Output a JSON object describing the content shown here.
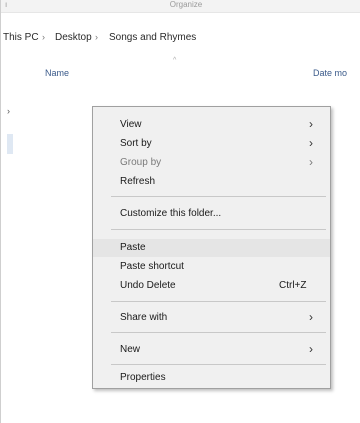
{
  "window": {
    "title_left": "ı",
    "title": "Organize"
  },
  "breadcrumb": {
    "items": [
      "This PC",
      "Desktop",
      "Songs and Rhymes"
    ],
    "separator": "›"
  },
  "columns": {
    "name": "Name",
    "date_modified": "Date mo",
    "sort_indicator": "^"
  },
  "navpane": {
    "arrow": "›"
  },
  "context_menu": {
    "items": [
      {
        "label": "View",
        "submenu": true
      },
      {
        "label": "Sort by",
        "submenu": true
      },
      {
        "label": "Group by",
        "submenu": true,
        "disabled": true
      },
      {
        "label": "Refresh"
      },
      {
        "label": "Customize this folder..."
      },
      {
        "label": "Paste",
        "highlighted": true
      },
      {
        "label": "Paste shortcut"
      },
      {
        "label": "Undo Delete",
        "shortcut": "Ctrl+Z"
      },
      {
        "label": "Share with",
        "submenu": true
      },
      {
        "label": "New",
        "submenu": true
      },
      {
        "label": "Properties"
      }
    ],
    "submenu_glyph": "›"
  }
}
